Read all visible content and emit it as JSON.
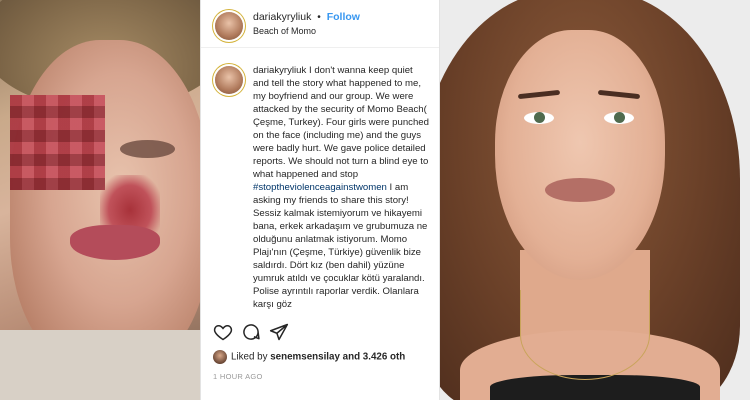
{
  "post": {
    "username": "dariakyryliuk",
    "separator": "•",
    "follow_label": "Follow",
    "location": "Beach of Momo",
    "caption_user": "dariakyryliuk",
    "caption_part1": " I don't wanna keep quiet and tell the story what happened to me, my boyfriend and our group. We were attacked by the security of Momo Beach( Çeşme, Turkey). Four girls were punched on the face (including me) and the guys were badly hurt. We gave police detailed reports. We should not turn a blind eye to what happened and stop ",
    "caption_hashtag": "#stoptheviolenceagainstwomen",
    "caption_part2": " I am asking my friends to share this story! Sessiz kalmak istemiyorum ve hikayemi bana, erkek arkadaşım ve grubumuza ne olduğunu anlatmak istiyorum. Momo Plajı'nın (Çeşme, Türkiye) güvenlik bize saldırdı. Dört kız (ben dahil) yüzüne yumruk atıldı ve çocuklar kötü yaralandı. Polise ayrıntılı raporlar verdik. Olanlara karşı göz",
    "likes_prefix": "Liked by ",
    "likes_user": "senemsensilay",
    "likes_suffix": " and 3.426 oth",
    "time_ago": "1 HOUR AGO"
  },
  "icons": {
    "like": "heart-icon",
    "comment": "comment-icon",
    "share": "share-icon"
  },
  "colors": {
    "follow": "#3897f0",
    "hashtag": "#003569",
    "text": "#262626",
    "muted": "#999999"
  }
}
